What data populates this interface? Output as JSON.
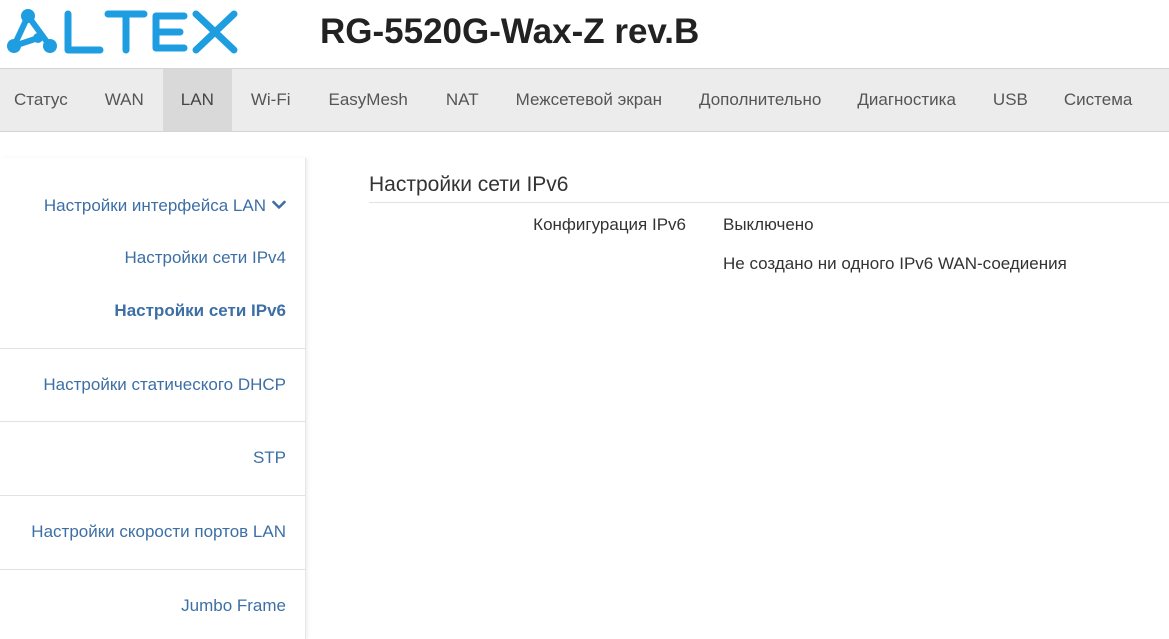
{
  "header": {
    "logo_text": "ELTEX",
    "model": "RG-5520G-Wax-Z rev.B"
  },
  "colors": {
    "brand": "#1e9ee0",
    "link": "#3d6fa5",
    "nav_bg": "#ececec",
    "nav_active": "#d9d9d9"
  },
  "nav": {
    "tabs": [
      {
        "label": "Статус"
      },
      {
        "label": "WAN"
      },
      {
        "label": "LAN"
      },
      {
        "label": "Wi-Fi"
      },
      {
        "label": "EasyMesh"
      },
      {
        "label": "NAT"
      },
      {
        "label": "Межсетевой экран"
      },
      {
        "label": "Дополнительно"
      },
      {
        "label": "Диагностика"
      },
      {
        "label": "USB"
      },
      {
        "label": "Система"
      }
    ],
    "active": "LAN"
  },
  "sidebar": {
    "group_label": "Настройки интерфейса LAN",
    "group_icon": "chevron-down-icon",
    "items": [
      {
        "label": "Настройки сети IPv4"
      },
      {
        "label": "Настройки сети IPv6"
      },
      {
        "label": "Настройки статического DHCP"
      },
      {
        "label": "STP"
      },
      {
        "label": "Настройки скорости портов LAN"
      },
      {
        "label": "Jumbo Frame"
      }
    ],
    "selected": "Настройки сети IPv6"
  },
  "main": {
    "title": "Настройки сети IPv6",
    "config_label": "Конфигурация IPv6",
    "config_value": "Выключено",
    "note": "Не создано ни одного IPv6 WAN-соедиения"
  }
}
